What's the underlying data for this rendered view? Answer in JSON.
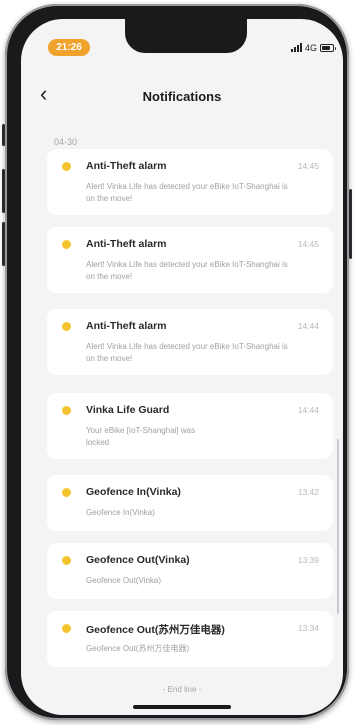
{
  "status_bar": {
    "time": "21:26",
    "network": "4G"
  },
  "header": {
    "back_icon": "‹",
    "title": "Notifications"
  },
  "date_label": "04-30",
  "notifications": [
    {
      "title": "Anti-Theft alarm",
      "time": "14:45",
      "body": "Alert! Vinka Life has detected your eBike IoT-Shanghai is on the move!"
    },
    {
      "title": "Anti-Theft alarm",
      "time": "14:45",
      "body": "Alert! Vinka Life has detected your eBike IoT-Shanghai is on the move!"
    },
    {
      "title": "Anti-Theft alarm",
      "time": "14:44",
      "body": "Alert! Vinka Life has detected your eBike IoT-Shanghai is on the move!"
    },
    {
      "title": "Vinka Life Guard",
      "time": "14:44",
      "body": "Your eBike [IoT-Shanghai] was locked"
    },
    {
      "title": "Geofence In(Vinka)",
      "time": "13:42",
      "body": "Geofence In(Vinka)"
    },
    {
      "title": "Geofence Out(Vinka)",
      "time": "13:39",
      "body": "Geofence Out(Vinka)"
    },
    {
      "title": "Geofence Out(苏州万佳电器)",
      "time": "13:34",
      "body": "Geofence Out(苏州万佳电器)"
    }
  ],
  "end_line": "- End line -",
  "colors": {
    "time_pill": "#f0a32c",
    "dot": "#f4c330",
    "background": "#f4f4f6"
  }
}
